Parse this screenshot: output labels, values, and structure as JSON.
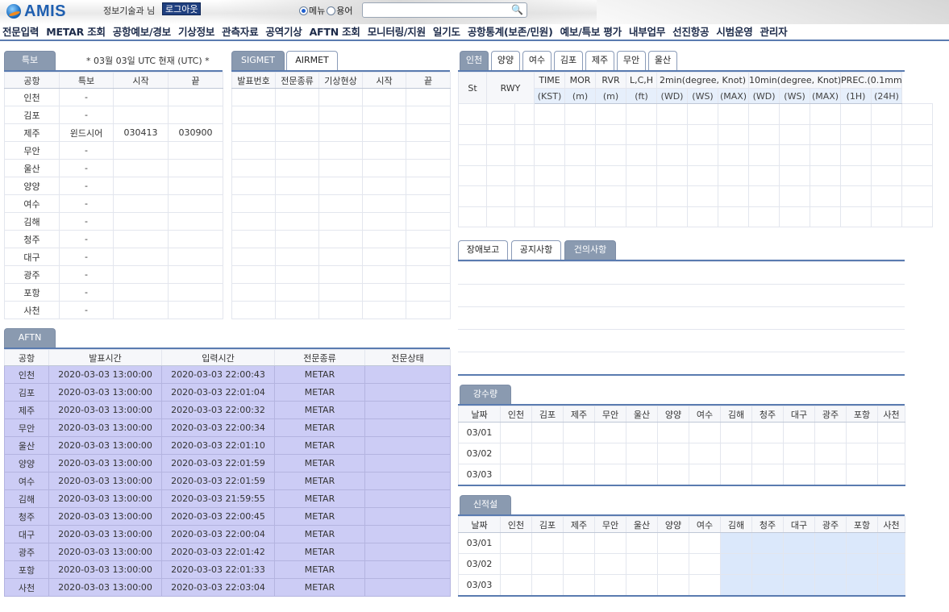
{
  "app": {
    "logo": "AMIS",
    "user": "정보기술과 님",
    "logout": "로그아웃",
    "radio_menu": "메뉴",
    "radio_term": "용어",
    "search_placeholder": ""
  },
  "nav": [
    "전문입력",
    "METAR 조회",
    "공항예보/경보",
    "기상정보",
    "관측자료",
    "공역기상",
    "AFTN 조회",
    "모니터링/지원",
    "일기도",
    "공항통계(보존/민원)",
    "예보/특보 평가",
    "내부업무",
    "선진항공",
    "시범운영",
    "관리자"
  ],
  "warning": {
    "tab": "특보",
    "note": "* 03월 03일 UTC 현재 (UTC) *",
    "headers": [
      "공항",
      "특보",
      "시작",
      "끝"
    ],
    "rows": [
      [
        "인천",
        "-",
        "",
        ""
      ],
      [
        "김포",
        "-",
        "",
        ""
      ],
      [
        "제주",
        "윈드시어",
        "030413",
        "030900"
      ],
      [
        "무안",
        "-",
        "",
        ""
      ],
      [
        "울산",
        "-",
        "",
        ""
      ],
      [
        "양양",
        "-",
        "",
        ""
      ],
      [
        "여수",
        "-",
        "",
        ""
      ],
      [
        "김해",
        "-",
        "",
        ""
      ],
      [
        "청주",
        "-",
        "",
        ""
      ],
      [
        "대구",
        "-",
        "",
        ""
      ],
      [
        "광주",
        "-",
        "",
        ""
      ],
      [
        "포항",
        "-",
        "",
        ""
      ],
      [
        "사천",
        "-",
        "",
        ""
      ]
    ]
  },
  "sigmet": {
    "tabs": [
      "SIGMET",
      "AIRMET"
    ],
    "headers": [
      "발표번호",
      "전문종류",
      "기상현상",
      "시작",
      "끝"
    ]
  },
  "aftn": {
    "tab": "AFTN",
    "headers": [
      "공항",
      "발표시간",
      "입력시간",
      "전문종류",
      "전문상태"
    ],
    "rows": [
      [
        "인천",
        "2020-03-03 13:00:00",
        "2020-03-03 22:00:43",
        "METAR",
        ""
      ],
      [
        "김포",
        "2020-03-03 13:00:00",
        "2020-03-03 22:01:04",
        "METAR",
        ""
      ],
      [
        "제주",
        "2020-03-03 13:00:00",
        "2020-03-03 22:00:32",
        "METAR",
        ""
      ],
      [
        "무안",
        "2020-03-03 13:00:00",
        "2020-03-03 22:00:34",
        "METAR",
        ""
      ],
      [
        "울산",
        "2020-03-03 13:00:00",
        "2020-03-03 22:01:10",
        "METAR",
        ""
      ],
      [
        "양양",
        "2020-03-03 13:00:00",
        "2020-03-03 22:01:59",
        "METAR",
        ""
      ],
      [
        "여수",
        "2020-03-03 13:00:00",
        "2020-03-03 22:01:59",
        "METAR",
        ""
      ],
      [
        "김해",
        "2020-03-03 13:00:00",
        "2020-03-03 21:59:55",
        "METAR",
        ""
      ],
      [
        "청주",
        "2020-03-03 13:00:00",
        "2020-03-03 22:00:45",
        "METAR",
        ""
      ],
      [
        "대구",
        "2020-03-03 13:00:00",
        "2020-03-03 22:00:04",
        "METAR",
        ""
      ],
      [
        "광주",
        "2020-03-03 13:00:00",
        "2020-03-03 22:01:42",
        "METAR",
        ""
      ],
      [
        "포항",
        "2020-03-03 13:00:00",
        "2020-03-03 22:01:33",
        "METAR",
        ""
      ],
      [
        "사천",
        "2020-03-03 13:00:00",
        "2020-03-03 22:03:04",
        "METAR",
        ""
      ]
    ]
  },
  "obs": {
    "tabs": [
      "인천",
      "양양",
      "여수",
      "김포",
      "제주",
      "무안",
      "울산"
    ],
    "h1": [
      "St",
      "RWY",
      "TIME",
      "MOR",
      "RVR",
      "L,C,H",
      "2min(degree, Knot)",
      "10min(degree, Knot)",
      "PREC.(0.1mm"
    ],
    "h2": [
      "(KST)",
      "(m)",
      "(m)",
      "(ft)",
      "(WD)",
      "(WS)",
      "(MAX)",
      "(WD)",
      "(WS)",
      "(MAX)",
      "(1H)",
      "(24H)"
    ]
  },
  "report": {
    "tabs": [
      "장애보고",
      "공지사항",
      "건의사항"
    ]
  },
  "rain": {
    "tab": "강수량",
    "headers": [
      "날짜",
      "인천",
      "김포",
      "제주",
      "무안",
      "울산",
      "양양",
      "여수",
      "김해",
      "청주",
      "대구",
      "광주",
      "포항",
      "사천"
    ],
    "dates": [
      "03/01",
      "03/02",
      "03/03"
    ]
  },
  "snow": {
    "tab": "신적설",
    "headers": [
      "날짜",
      "인천",
      "김포",
      "제주",
      "무안",
      "울산",
      "양양",
      "여수",
      "김해",
      "청주",
      "대구",
      "광주",
      "포항",
      "사천"
    ],
    "dates": [
      "03/01",
      "03/02",
      "03/03"
    ]
  }
}
